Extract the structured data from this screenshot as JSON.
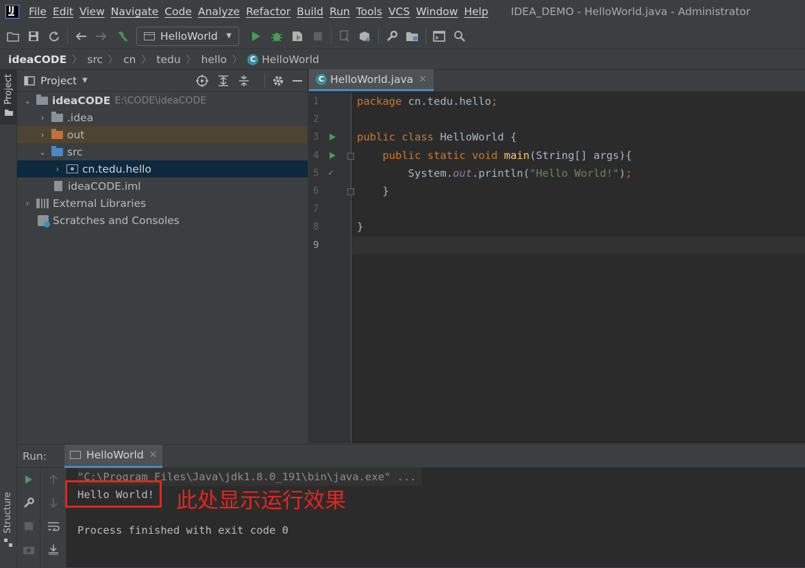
{
  "menu": {
    "items": [
      "File",
      "Edit",
      "View",
      "Navigate",
      "Code",
      "Analyze",
      "Refactor",
      "Build",
      "Run",
      "Tools",
      "VCS",
      "Window",
      "Help"
    ],
    "window_title": "IDEA_DEMO - HelloWorld.java - Administrator"
  },
  "toolbar": {
    "run_config": "HelloWorld",
    "icons": [
      "open-folder-icon",
      "save-icon",
      "sync-icon",
      "back-arrow-icon",
      "forward-arrow-icon",
      "build-hammer-icon",
      "run-icon",
      "debug-icon",
      "coverage-icon",
      "stop-icon",
      "attach-icon",
      "sdk-icon",
      "settings-icon",
      "project-structure-icon",
      "terminal-icon",
      "search-icon"
    ]
  },
  "breadcrumb": [
    "ideaCODE",
    "src",
    "cn",
    "tedu",
    "hello",
    "HelloWorld"
  ],
  "side_tabs": {
    "project": "Project",
    "structure": "Structure"
  },
  "project_panel": {
    "title": "Project",
    "tree": {
      "root_name": "ideaCODE",
      "root_path": "E:\\CODE\\ideaCODE",
      "idea": ".idea",
      "out": "out",
      "src": "src",
      "package": "cn.tedu.hello",
      "iml": "ideaCODE.iml",
      "external": "External Libraries",
      "scratches": "Scratches and Consoles"
    }
  },
  "editor": {
    "tab": "HelloWorld.java",
    "line_numbers": [
      "1",
      "2",
      "3",
      "4",
      "5",
      "6",
      "7",
      "8",
      "9"
    ],
    "code": {
      "l1_kw": "package",
      "l1_rest": " cn.tedu.hello",
      "l1_semi": ";",
      "l3_kw": "public class",
      "l3_rest": " HelloWorld {",
      "l4_indent": "    ",
      "l4_kw": "public static void",
      "l4_fn": " main",
      "l4_rest": "(String[] args){",
      "l5_indent": "        ",
      "l5_obj": "System.",
      "l5_field": "out",
      "l5_call": ".println(",
      "l5_str": "\"Hello World!\"",
      "l5_close": ")",
      "l5_semi": ";",
      "l6": "    }",
      "l8": "}"
    }
  },
  "run_panel": {
    "label": "Run:",
    "tab": "HelloWorld",
    "console": {
      "command": "\"C:\\Program Files\\Java\\jdk1.8.0_191\\bin\\java.exe\" ...",
      "output": "Hello World!",
      "exit": "Process finished with exit code 0"
    }
  },
  "annotation": {
    "text": "此处显示运行效果",
    "color": "#e5261d"
  },
  "colors": {
    "keyword": "#cc7832",
    "function": "#ffc66d",
    "string": "#6a8759",
    "field": "#9876aa",
    "run_green": "#499c54",
    "selection": "#0d293e"
  }
}
